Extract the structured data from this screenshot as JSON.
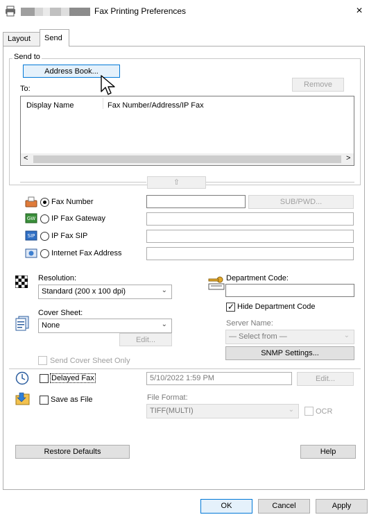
{
  "window": {
    "title": "Fax Printing Preferences",
    "close_glyph": "×"
  },
  "tabs": [
    "Layout",
    "Send"
  ],
  "send_to": {
    "group_label": "Send to",
    "address_book_button": "Address Book...",
    "to_label": "To:",
    "remove_button": "Remove",
    "columns": [
      "Display Name",
      "Fax Number/Address/IP Fax"
    ],
    "scroll_left": "<",
    "scroll_right": ">",
    "add_arrow": "⇧"
  },
  "destinations": {
    "fax_number": {
      "label": "Fax Number",
      "value": ""
    },
    "sub_pwd_button": "SUB/PWD...",
    "ip_fax_gateway": {
      "label": "IP Fax Gateway",
      "value": ""
    },
    "ip_fax_sip": {
      "label": "IP Fax SIP",
      "value": ""
    },
    "internet_fax": {
      "label": "Internet Fax Address",
      "value": ""
    }
  },
  "resolution": {
    "label": "Resolution:",
    "value": "Standard (200 x 100 dpi)"
  },
  "department": {
    "label": "Department Code:",
    "value": "",
    "hide_label": "Hide Department Code"
  },
  "cover_sheet": {
    "label": "Cover Sheet:",
    "value": "None",
    "edit_button": "Edit...",
    "send_only_label": "Send Cover Sheet Only"
  },
  "server": {
    "label": "Server Name:",
    "value": "— Select from —",
    "snmp_button": "SNMP Settings..."
  },
  "delayed": {
    "label": "Delayed Fax",
    "value": "5/10/2022 1:59 PM",
    "edit_button": "Edit..."
  },
  "save_file": {
    "label": "Save as File",
    "format_label": "File Format:",
    "format_value": "TIFF(MULTI)",
    "ocr_label": "OCR"
  },
  "bottom": {
    "restore_button": "Restore Defaults",
    "help_button": "Help"
  },
  "dialog": {
    "ok": "OK",
    "cancel": "Cancel",
    "apply": "Apply"
  }
}
